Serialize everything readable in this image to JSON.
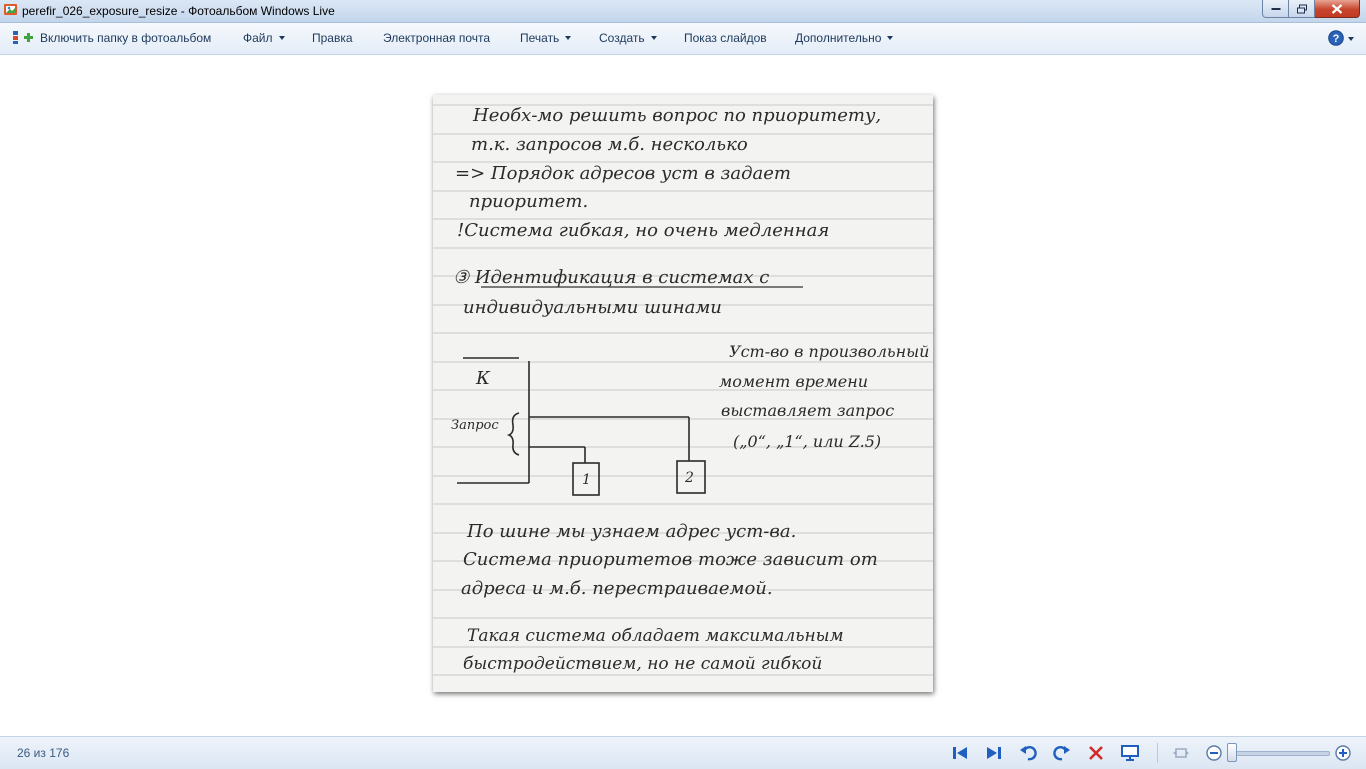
{
  "window": {
    "title": "perefir_026_exposure_resize - Фотоальбом Windows Live"
  },
  "command_bar": {
    "include_folder": "Включить папку в фотоальбом",
    "file": "Файл",
    "edit": "Правка",
    "email": "Электронная почта",
    "print": "Печать",
    "create": "Создать",
    "slideshow": "Показ слайдов",
    "extras": "Дополнительно"
  },
  "photo": {
    "lines": [
      "Необх-мо решить вопрос по приоритету,",
      "т.к. запросов м.б. несколько",
      "=> Порядок адресов уст в задает",
      "приоритет.",
      "!Система гибкая, но очень медленная",
      "③ Идентификация в системах с",
      "индивидуальными шинами",
      "Уст-во в произвольный",
      "момент времени",
      "выставляет запрос",
      "(„0“, „1“, или Z.5)",
      "К",
      "Запрос",
      "1",
      "2",
      "По шине мы узнаем адрес уст-ва.",
      "Система приоритетов тоже зависит от",
      "адреса и м.б. перестраиваемой.",
      "Такая система обладает максимальным",
      "быстродействием, но не самой гибкой"
    ]
  },
  "status": {
    "counter": "26 из 176"
  },
  "colors": {
    "accent": "#1e5fc0",
    "delete_red": "#d22a2a",
    "bar_top": "#f6f9fd",
    "bar_bottom": "#dbe6f3"
  }
}
